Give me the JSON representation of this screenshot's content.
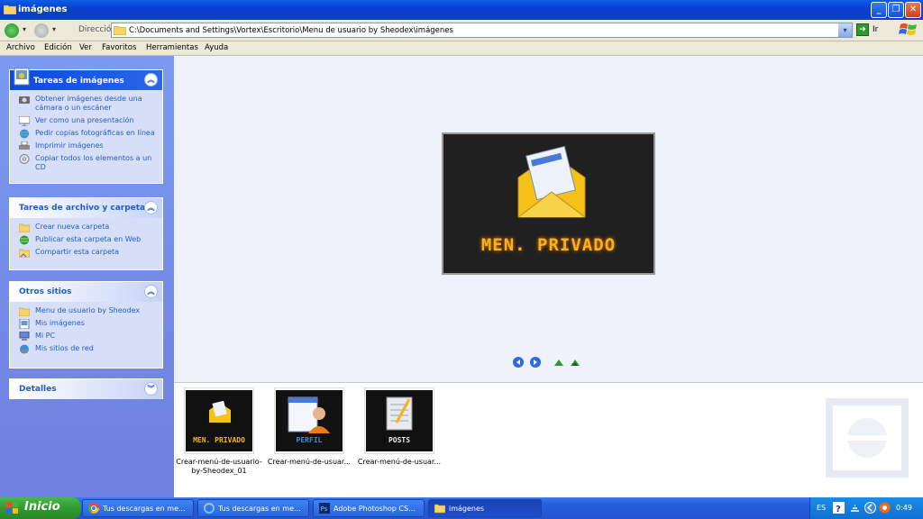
{
  "window": {
    "title": "imágenes",
    "minimize_label": "_",
    "maximize_label": "❐",
    "close_label": "✕"
  },
  "address": {
    "label": "Dirección",
    "path": "C:\\Documents and Settings\\Vortex\\Escritorio\\Menu de usuario by Sheodex\\imágenes",
    "go_label": "Ir",
    "dropdown_glyph": "▾"
  },
  "nav": {
    "back_arrow": "▾",
    "forward_arrow": "▾"
  },
  "menu": [
    "Archivo",
    "Edición",
    "Ver",
    "Favoritos",
    "Herramientas",
    "Ayuda"
  ],
  "panels": {
    "image_tasks": {
      "title": "Tareas de imágenes",
      "items": [
        "Obtener imágenes desde una cámara o un escáner",
        "Ver como una presentación",
        "Pedir copias fotográficas en línea",
        "Imprimir imágenes",
        "Copiar todos los elementos a un CD"
      ]
    },
    "file_tasks": {
      "title": "Tareas de archivo y carpeta",
      "items": [
        "Crear nueva carpeta",
        "Publicar esta carpeta en Web",
        "Compartir esta carpeta"
      ]
    },
    "other_places": {
      "title": "Otros sitios",
      "items": [
        "Menu de usuario by Sheodex",
        "Mis imágenes",
        "Mi PC",
        "Mis sitios de red"
      ]
    },
    "details": {
      "title": "Detalles"
    }
  },
  "chevrons": {
    "up": "︽",
    "down": "︾"
  },
  "preview": {
    "text": "MEN. PRIVADO"
  },
  "thumbnails": [
    {
      "caption": "Crear-menú-de-usuario-by-Sheodex_01",
      "text": "MEN. PRIVADO"
    },
    {
      "caption": "Crear-menú-de-usuar...",
      "text": "PERFIL"
    },
    {
      "caption": "Crear-menú-de-usuar...",
      "text": "POSTS"
    }
  ],
  "taskbar": {
    "start_label": "Inicio",
    "buttons": [
      "Tus descargas en me...",
      "Tus descargas en me...",
      "Adobe Photoshop CS...",
      "imágenes"
    ],
    "tray": {
      "lang": "ES",
      "time": "0:49"
    }
  },
  "colors": {
    "accent": "#215dc6",
    "title_bar": "#0a3fd0",
    "sidebar": "#7a9af0",
    "preview_text": "#f6b21c"
  }
}
